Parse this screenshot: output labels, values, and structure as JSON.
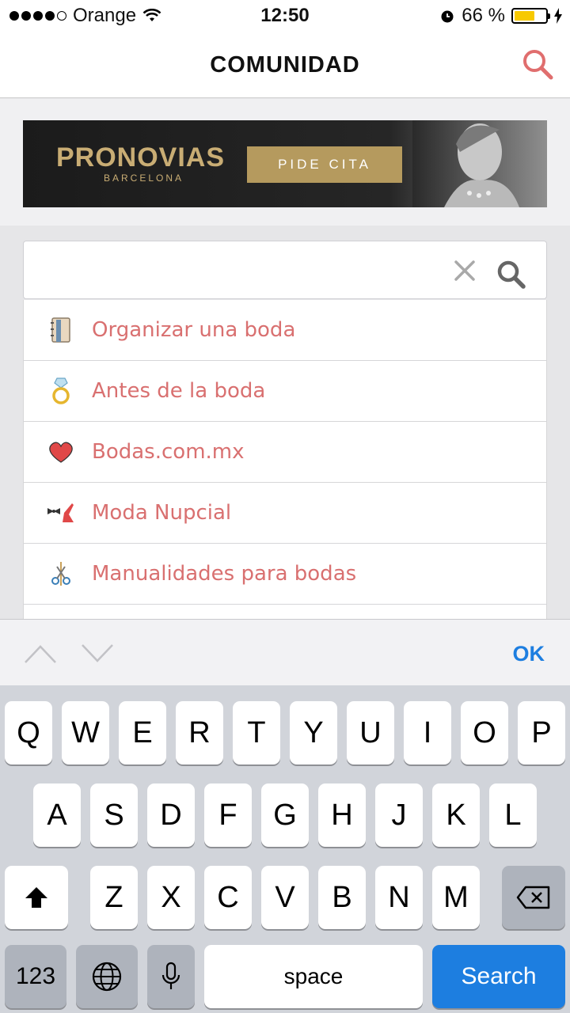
{
  "status_bar": {
    "carrier": "Orange",
    "time": "12:50",
    "battery_percent": "66 %",
    "battery_level": 0.66,
    "battery_color": "#f7c900"
  },
  "navbar": {
    "title": "COMUNIDAD",
    "search_icon": "search-icon",
    "accent_color": "#e06e6e"
  },
  "ad": {
    "brand": "PRONOVIAS",
    "sub": "BARCELONA",
    "cta": "PIDE CITA"
  },
  "search": {
    "value": "",
    "placeholder": ""
  },
  "categories": [
    {
      "label": "Organizar una boda",
      "icon": "notebook-icon"
    },
    {
      "label": "Antes de la boda",
      "icon": "ring-icon"
    },
    {
      "label": "Bodas.com.mx",
      "icon": "heart-icon"
    },
    {
      "label": "Moda Nupcial",
      "icon": "bowtie-heel-icon"
    },
    {
      "label": "Manualidades para bodas",
      "icon": "scissors-icon"
    }
  ],
  "accessory": {
    "ok_label": "OK"
  },
  "keyboard": {
    "row1": [
      "Q",
      "W",
      "E",
      "R",
      "T",
      "Y",
      "U",
      "I",
      "O",
      "P"
    ],
    "row2": [
      "A",
      "S",
      "D",
      "F",
      "G",
      "H",
      "J",
      "K",
      "L"
    ],
    "row3": [
      "Z",
      "X",
      "C",
      "V",
      "B",
      "N",
      "M"
    ],
    "numbers_label": "123",
    "space_label": "space",
    "search_label": "Search",
    "search_color": "#1d7ee0"
  }
}
